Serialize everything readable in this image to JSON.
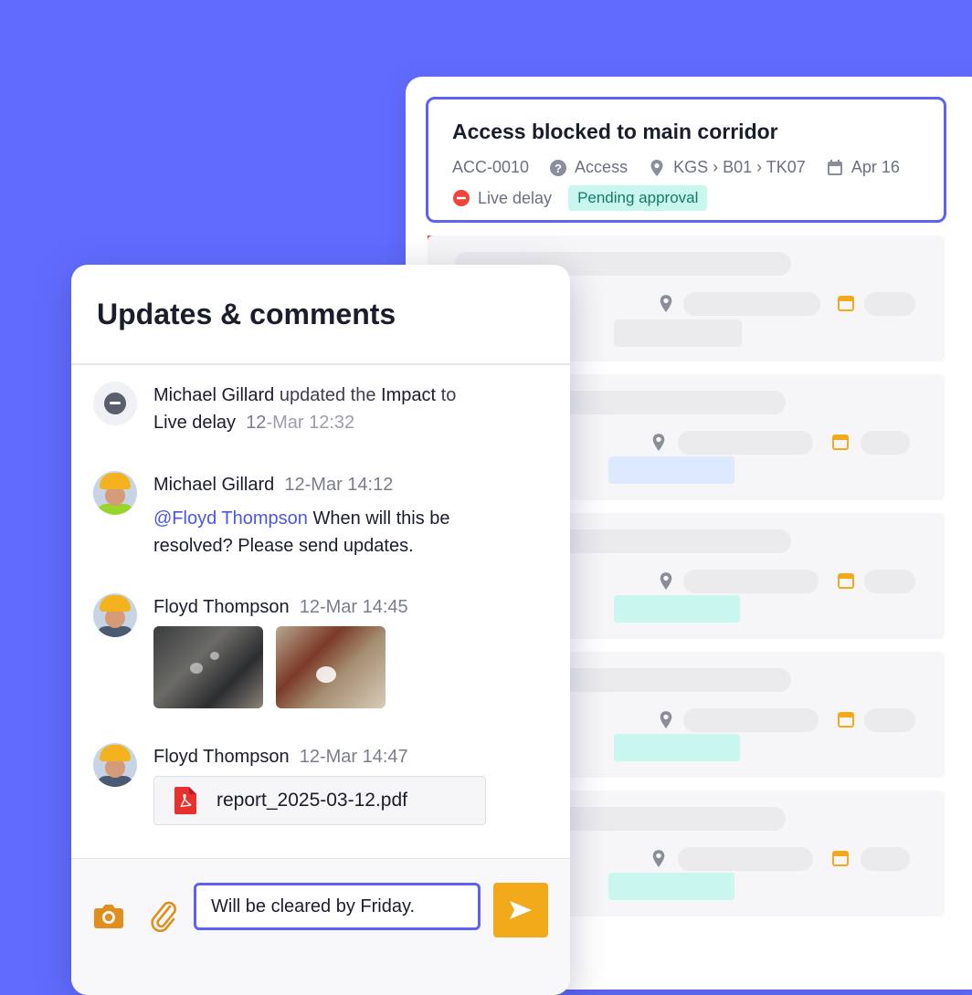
{
  "issue": {
    "title": "Access blocked to main corridor",
    "id": "ACC-0010",
    "category": "Access",
    "location": "KGS › B01 › TK07",
    "date": "Apr 16",
    "impact": "Live delay",
    "status": "Pending approval"
  },
  "comments_panel": {
    "title": "Updates & comments",
    "entries": [
      {
        "type": "system",
        "actor": "Michael Gillard",
        "action": "updated the",
        "field": "Impact",
        "to_word": "to",
        "value": "Live delay",
        "time_day": "12",
        "time_rest": "-Mar 12:32"
      },
      {
        "type": "comment",
        "author": "Michael Gillard",
        "time": "12-Mar 14:12",
        "mention": "@Floyd Thompson",
        "text_line1": "When will this be",
        "text_line2": "resolved? Please send updates."
      },
      {
        "type": "photos",
        "author": "Floyd Thompson",
        "time": "12-Mar 14:45"
      },
      {
        "type": "file",
        "author": "Floyd Thompson",
        "time": "12-Mar 14:47",
        "file_name": "report_2025-03-12.pdf"
      }
    ],
    "composer": {
      "value": "Will be cleared by Friday."
    }
  },
  "icons": {
    "category": "question-icon",
    "location": "pin-icon",
    "date": "calendar-icon",
    "impact": "minus-circle-icon",
    "camera": "camera-icon",
    "attach": "paperclip-icon",
    "send": "send-icon",
    "file": "pdf-icon"
  },
  "colors": {
    "background": "#616cff",
    "accent": "#5b63f0",
    "send_button": "#f2a91a",
    "pending_bg": "#c9f6ef",
    "live_delay": "#f0453a"
  }
}
